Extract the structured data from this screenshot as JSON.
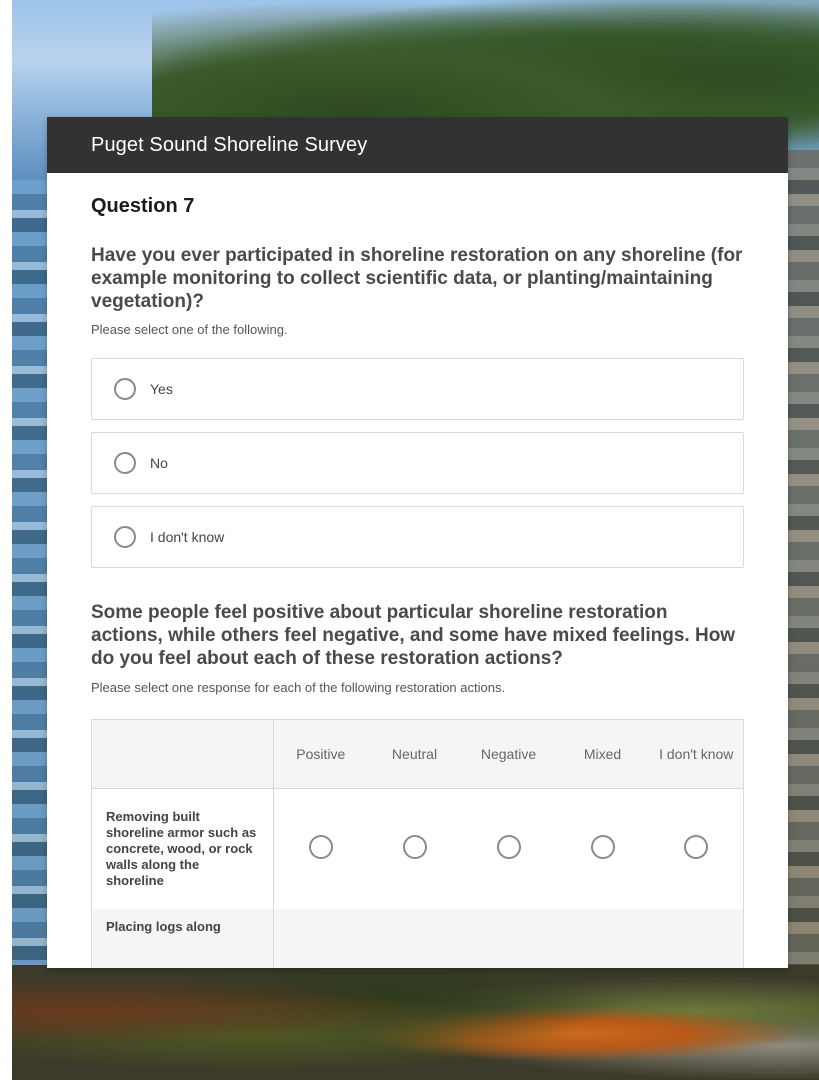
{
  "survey": {
    "title": "Puget Sound Shoreline Survey"
  },
  "question7": {
    "number": "Question 7",
    "text": "Have you ever participated in shoreline restoration on any shoreline (for example monitoring to collect scientific data, or planting/maintaining vegetation)?",
    "hint": "Please select one of the following.",
    "options": [
      {
        "label": "Yes",
        "selected": false
      },
      {
        "label": "No",
        "selected": false
      },
      {
        "label": "I don't know",
        "selected": false
      }
    ]
  },
  "question8": {
    "text": "Some people feel positive about particular shoreline restoration actions, while others feel negative, and some have mixed feelings. How do you feel about each of these restoration actions?",
    "hint": "Please select one response for each of the following restoration actions.",
    "columns": [
      "Positive",
      "Neutral",
      "Negative",
      "Mixed",
      "I don't know"
    ],
    "rows": [
      {
        "label": "Removing built shoreline armor such as concrete, wood, or rock walls along the shoreline"
      },
      {
        "label": "Placing logs along"
      }
    ]
  }
}
